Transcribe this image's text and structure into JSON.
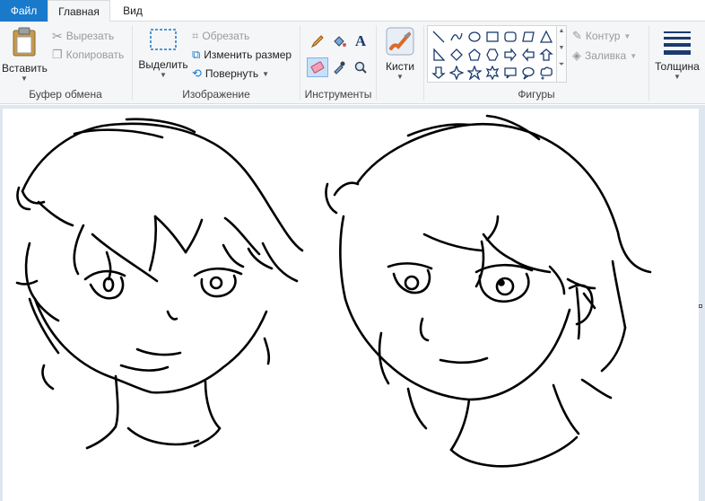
{
  "tabs": {
    "file": "Файл",
    "home": "Главная",
    "view": "Вид"
  },
  "clipboard": {
    "paste_label": "Вставить",
    "cut_label": "Вырезать",
    "copy_label": "Копировать",
    "group_label": "Буфер обмена"
  },
  "image": {
    "select_label": "Выделить",
    "crop_label": "Обрезать",
    "resize_label": "Изменить размер",
    "rotate_label": "Повернуть",
    "group_label": "Изображение"
  },
  "tools": {
    "group_label": "Инструменты"
  },
  "brushes": {
    "label": "Кисти"
  },
  "shapes": {
    "outline_label": "Контур",
    "fill_label": "Заливка",
    "group_label": "Фигуры"
  },
  "size": {
    "label": "Толщина"
  },
  "colors": {
    "accent": "#1979ca",
    "ribbon": "#f5f6f7",
    "workspace": "#dee6f1"
  }
}
